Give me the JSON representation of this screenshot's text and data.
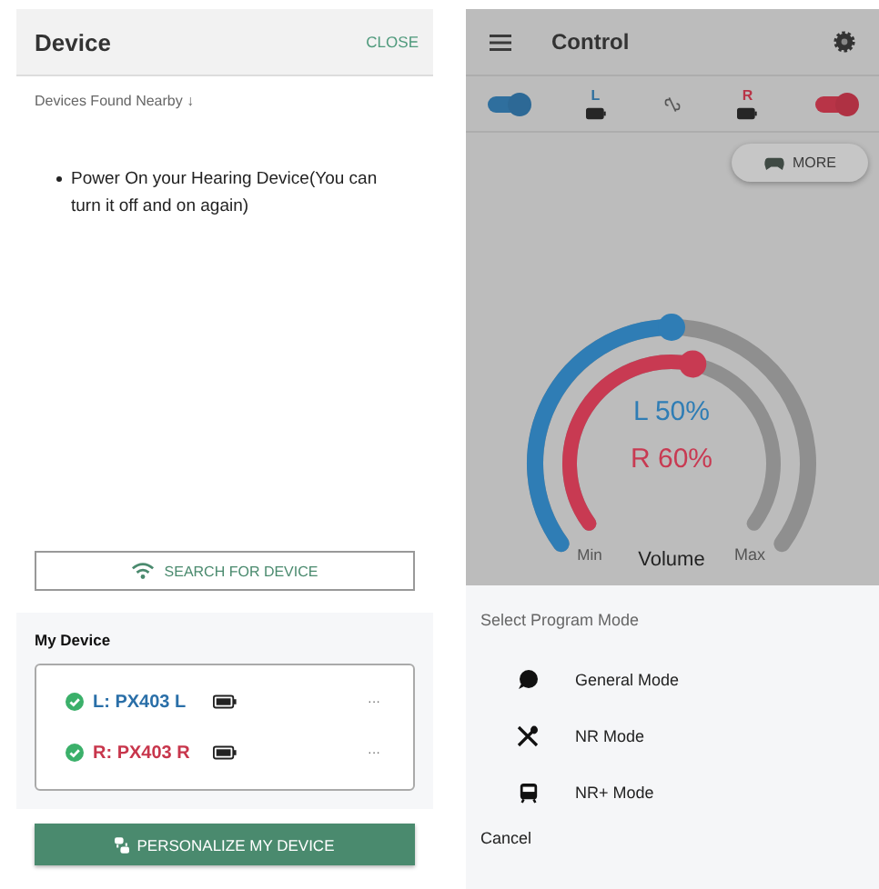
{
  "device_panel": {
    "title": "Device",
    "close": "CLOSE",
    "nearby_label": "Devices Found Nearby ↓",
    "instructions": [
      "Power On your Hearing Device(You can turn it off and on again)"
    ],
    "search_button": "SEARCH FOR DEVICE",
    "my_device": {
      "title": "My Device",
      "devices": [
        {
          "name": "L: PX403 L",
          "color": "#2a6fa8",
          "connected": true,
          "more": "···"
        },
        {
          "name": "R: PX403 R",
          "color": "#c8364c",
          "connected": true,
          "more": "···"
        }
      ]
    },
    "personalize_button": "PERSONALIZE MY DEVICE"
  },
  "control_panel": {
    "title": "Control",
    "ears": [
      {
        "label": "L",
        "color": "#2f6f9e",
        "on": true
      },
      {
        "label": "R",
        "color": "#b83447",
        "on": true
      }
    ],
    "more_button": "MORE",
    "volume": {
      "label": "Volume",
      "min": "Min",
      "max": "Max",
      "channels": [
        {
          "reading": "L 50%",
          "color": "#2f7db5"
        },
        {
          "reading": "R 60%",
          "color": "#c83a52"
        }
      ]
    },
    "sheet": {
      "title": "Select Program Mode",
      "modes": [
        {
          "label": "General Mode",
          "kind": "chat"
        },
        {
          "label": "NR Mode",
          "kind": "dining"
        },
        {
          "label": "NR+ Mode",
          "kind": "train"
        }
      ],
      "cancel": "Cancel"
    }
  }
}
